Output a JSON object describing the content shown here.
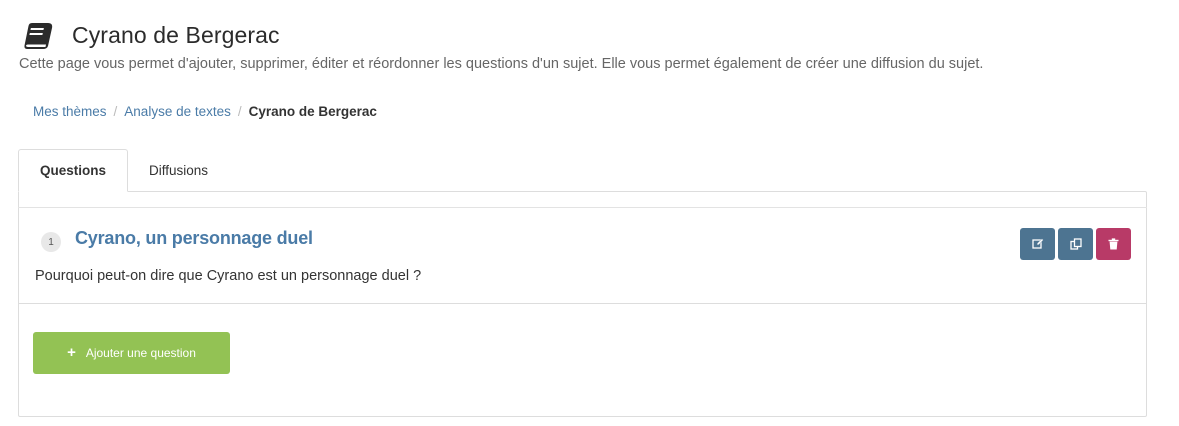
{
  "header": {
    "icon": "book-icon",
    "title": "Cyrano de Bergerac",
    "subtitle": "Cette page vous permet d'ajouter, supprimer, éditer et réordonner les questions d'un sujet. Elle vous permet également de créer une diffusion du sujet."
  },
  "breadcrumb": {
    "items": [
      "Mes thèmes",
      "Analyse de textes"
    ],
    "current": "Cyrano de Bergerac"
  },
  "tabs": [
    {
      "label": "Questions",
      "active": true
    },
    {
      "label": "Diffusions",
      "active": false
    }
  ],
  "questions": [
    {
      "number": "1",
      "title": "Cyrano, un personnage duel",
      "text": "Pourquoi peut-on dire que Cyrano est un personnage duel ?",
      "actions": [
        "edit-icon",
        "copy-icon",
        "trash-icon"
      ]
    }
  ],
  "add_question": {
    "icon": "plus-icon",
    "label": "Ajouter une question"
  },
  "colors": {
    "link": "#4a7ba7",
    "edit_button": "#4d7491",
    "delete_button": "#b83a67",
    "add_button": "#93c254"
  }
}
